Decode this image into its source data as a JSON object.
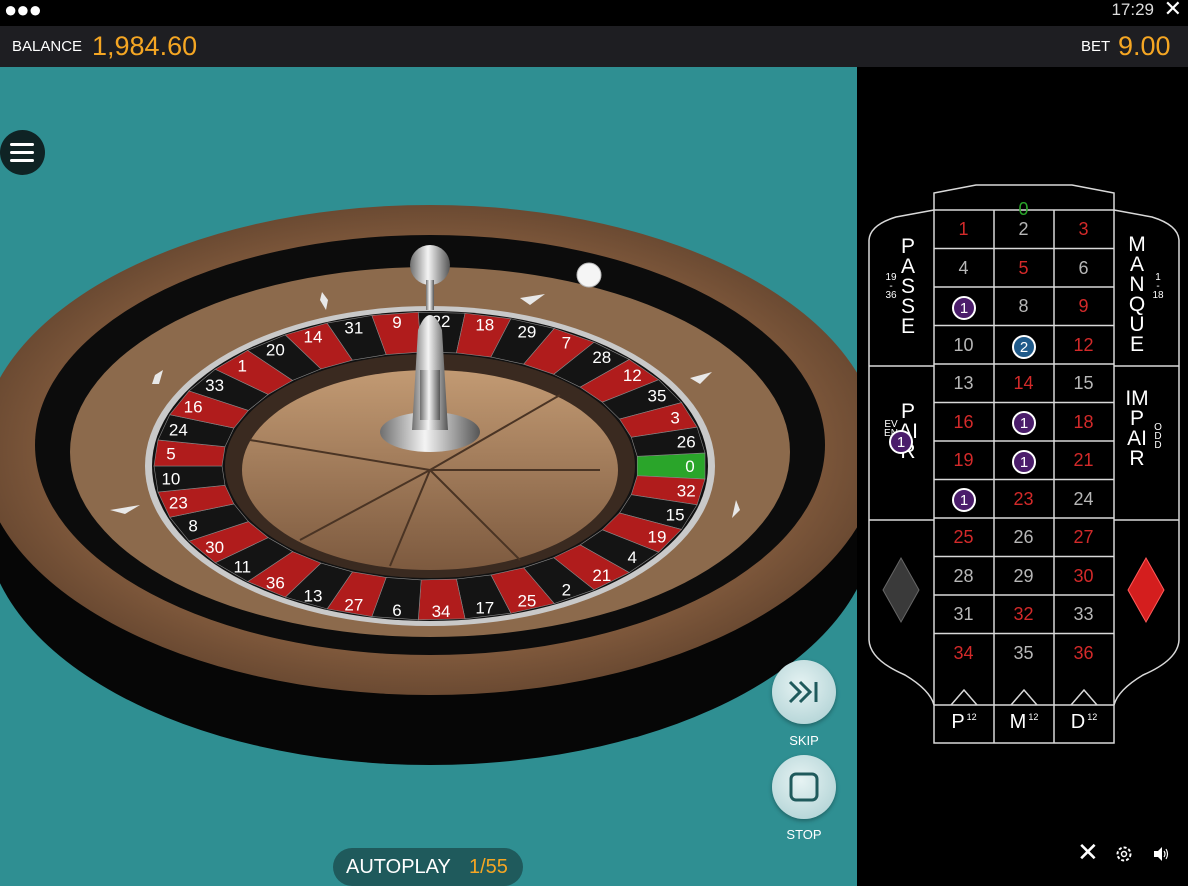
{
  "topbar": {
    "time": "17:29",
    "dots": "●●●",
    "close_glyph": "✕"
  },
  "status": {
    "balance_label": "BALANCE",
    "balance_value": "1,984.60",
    "bet_label": "BET",
    "bet_value": "9.00"
  },
  "controls": {
    "skip_label": "SKIP",
    "stop_label": "STOP",
    "autoplay_label": "AUTOPLAY",
    "autoplay_count": "1/55"
  },
  "wheel": {
    "sequence": [
      "0",
      "32",
      "15",
      "19",
      "4",
      "21",
      "2",
      "25",
      "17",
      "34",
      "6",
      "27",
      "13",
      "36",
      "11",
      "30",
      "8",
      "23",
      "10",
      "5",
      "24",
      "16",
      "33",
      "1",
      "20",
      "14",
      "31",
      "9",
      "22",
      "18",
      "29",
      "7",
      "28",
      "12",
      "35",
      "3",
      "26"
    ],
    "winning_number": "0"
  },
  "table": {
    "zero": "0",
    "rows": [
      [
        {
          "n": "1",
          "c": "red"
        },
        {
          "n": "2",
          "c": "grey"
        },
        {
          "n": "3",
          "c": "red"
        }
      ],
      [
        {
          "n": "4",
          "c": "grey"
        },
        {
          "n": "5",
          "c": "red"
        },
        {
          "n": "6",
          "c": "grey"
        }
      ],
      [
        {
          "n": "7",
          "c": "red"
        },
        {
          "n": "8",
          "c": "grey"
        },
        {
          "n": "9",
          "c": "red"
        }
      ],
      [
        {
          "n": "10",
          "c": "grey"
        },
        {
          "n": "11",
          "c": "grey"
        },
        {
          "n": "12",
          "c": "red"
        }
      ],
      [
        {
          "n": "13",
          "c": "grey"
        },
        {
          "n": "14",
          "c": "red"
        },
        {
          "n": "15",
          "c": "grey"
        }
      ],
      [
        {
          "n": "16",
          "c": "red"
        },
        {
          "n": "17",
          "c": "grey"
        },
        {
          "n": "18",
          "c": "red"
        }
      ],
      [
        {
          "n": "19",
          "c": "red"
        },
        {
          "n": "20",
          "c": "grey"
        },
        {
          "n": "21",
          "c": "red"
        }
      ],
      [
        {
          "n": "22",
          "c": "grey"
        },
        {
          "n": "23",
          "c": "red"
        },
        {
          "n": "24",
          "c": "grey"
        }
      ],
      [
        {
          "n": "25",
          "c": "red"
        },
        {
          "n": "26",
          "c": "grey"
        },
        {
          "n": "27",
          "c": "red"
        }
      ],
      [
        {
          "n": "28",
          "c": "grey"
        },
        {
          "n": "29",
          "c": "grey"
        },
        {
          "n": "30",
          "c": "red"
        }
      ],
      [
        {
          "n": "31",
          "c": "grey"
        },
        {
          "n": "32",
          "c": "red"
        },
        {
          "n": "33",
          "c": "grey"
        }
      ],
      [
        {
          "n": "34",
          "c": "red"
        },
        {
          "n": "35",
          "c": "grey"
        },
        {
          "n": "36",
          "c": "red"
        }
      ]
    ],
    "passe": "PASSE",
    "passe_range": [
      "19",
      "-",
      "36"
    ],
    "manque": "MANQUE",
    "manque_range": [
      "1",
      "-",
      "18"
    ],
    "pair": "PAIR",
    "pair_en": "EVEN",
    "impair": "IMPAIR",
    "impair_en": "ODD",
    "dozens": [
      {
        "label": "P",
        "sup": "12"
      },
      {
        "label": "M",
        "sup": "12"
      },
      {
        "label": "D",
        "sup": "12"
      }
    ],
    "chips": [
      {
        "value": "1",
        "color": "purple",
        "spot": "7"
      },
      {
        "value": "2",
        "color": "blue",
        "spot": "11"
      },
      {
        "value": "1",
        "color": "purple",
        "spot": "17"
      },
      {
        "value": "1",
        "color": "purple",
        "spot": "20"
      },
      {
        "value": "1",
        "color": "purple",
        "spot": "22"
      },
      {
        "value": "1",
        "color": "purple",
        "spot": "pair"
      }
    ]
  },
  "colors": {
    "accent": "#f5a623",
    "felt": "#2f8f92",
    "red": "#d32a2a",
    "green": "#2aa52a"
  }
}
